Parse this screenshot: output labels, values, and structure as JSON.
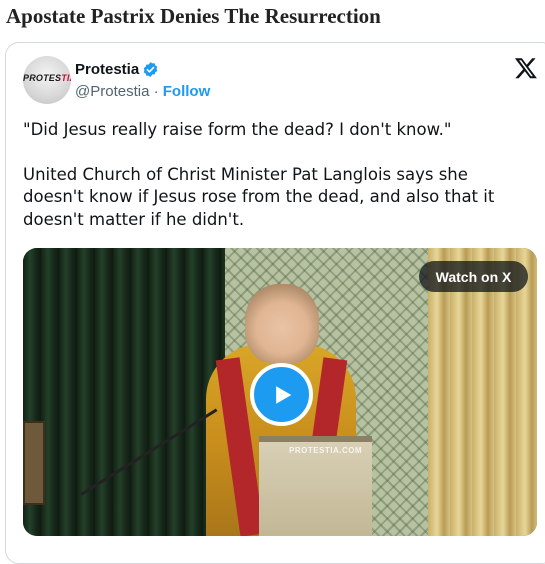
{
  "article": {
    "headline": "Apostate Pastrix Denies The Resurrection"
  },
  "tweet": {
    "author_name": "Protestia",
    "handle": "@Protestia",
    "separator": "·",
    "follow_label": "Follow",
    "avatar_text": "PROTES",
    "avatar_text_accent": "TIA",
    "text_line1": "\"Did Jesus really raise form the dead? I don't know.\"",
    "text_line2": "United Church of Christ Minister Pat Langlois says she doesn't know if Jesus rose from the dead, and also that it doesn't matter if he didn't.",
    "video": {
      "watch_label": "Watch on X",
      "podium_logo": "PROTESTIA.COM"
    }
  },
  "colors": {
    "accent": "#1d9bf0",
    "text": "#0f1419",
    "muted": "#536471",
    "border": "#cfd9de"
  },
  "icons": [
    "verified-badge-icon",
    "x-logo-icon",
    "play-icon"
  ]
}
